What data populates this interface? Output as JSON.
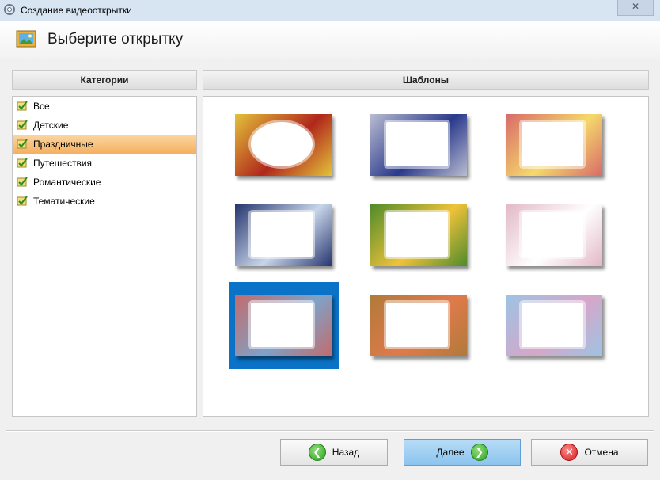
{
  "window": {
    "title": "Создание видеооткрытки",
    "close_glyph": "✕"
  },
  "header": {
    "title": "Выберите открытку",
    "icon": "picture-icon"
  },
  "categories": {
    "heading": "Категории",
    "items": [
      {
        "label": "Все",
        "selected": false
      },
      {
        "label": "Детские",
        "selected": false
      },
      {
        "label": "Праздничные",
        "selected": true
      },
      {
        "label": "Путешествия",
        "selected": false
      },
      {
        "label": "Романтические",
        "selected": false
      },
      {
        "label": "Тематические",
        "selected": false
      }
    ]
  },
  "templates": {
    "heading": "Шаблоны",
    "selected_index": 6,
    "items": [
      {
        "theme": "christmas-gifts",
        "colors": [
          "#e3c23a",
          "#b0271c"
        ]
      },
      {
        "theme": "winter-frost",
        "colors": [
          "#b9bcd0",
          "#2a3a8c"
        ]
      },
      {
        "theme": "red-roses",
        "colors": [
          "#d86a6a",
          "#f5d96b"
        ]
      },
      {
        "theme": "snowman-night",
        "colors": [
          "#26356e",
          "#c8d6ea"
        ]
      },
      {
        "theme": "spring-flowers",
        "colors": [
          "#4e8b2c",
          "#f0c23a"
        ]
      },
      {
        "theme": "white-flowers-pink",
        "colors": [
          "#e2b8c6",
          "#ffffff"
        ]
      },
      {
        "theme": "christmas-candles",
        "colors": [
          "#c36b6b",
          "#7fa2c8"
        ]
      },
      {
        "theme": "golden-frame-roses",
        "colors": [
          "#b07a3b",
          "#e07a4a"
        ]
      },
      {
        "theme": "blue-lace",
        "colors": [
          "#9cc4e4",
          "#d6a6c8"
        ]
      }
    ]
  },
  "buttons": {
    "back": "Назад",
    "next": "Далее",
    "cancel": "Отмена"
  },
  "colors": {
    "selection_orange": "#f5b060",
    "selection_blue": "#0a73c7",
    "primary_button": "#8cc4ee"
  }
}
